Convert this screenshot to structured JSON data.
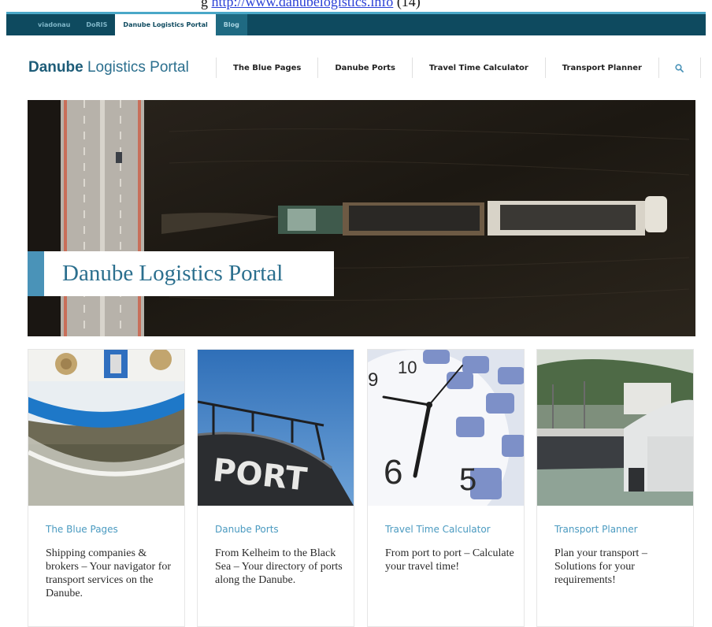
{
  "caption": {
    "text": "g",
    "link": "http://www.danubelogistics.info",
    "suffix": "(14)"
  },
  "topbar": {
    "tabs": [
      {
        "label": "viadonau"
      },
      {
        "label": "DoRIS"
      },
      {
        "label": "Danube Logistics Portal"
      },
      {
        "label": "Blog"
      }
    ],
    "colors": {
      "bar": "#0e4a5f",
      "accent": "#4aa8c8",
      "active_bg": "#ffffff"
    }
  },
  "header": {
    "logo_bold": "Danube",
    "logo_rest": " Logistics Portal",
    "nav": [
      {
        "label": "The Blue Pages"
      },
      {
        "label": "Danube Ports"
      },
      {
        "label": "Travel Time Calculator"
      },
      {
        "label": "Transport Planner"
      }
    ],
    "search_icon": "search-icon"
  },
  "hero": {
    "title": "Danube Logistics Portal",
    "image": "aerial-barge-on-river-with-bridge"
  },
  "cards": [
    {
      "title": "The Blue Pages",
      "description": "Shipping companies & brokers – Your navigator for transport services on the Danube.",
      "image": "ship-bow-with-ropes"
    },
    {
      "title": "Danube Ports",
      "description": "From Kelheim to the Black Sea – Your directory of ports along the Danube.",
      "image": "port-lettering-on-ship"
    },
    {
      "title": "Travel Time Calculator",
      "description": "From port to port – Calculate your travel time!",
      "image": "clock-and-calculator"
    },
    {
      "title": "Transport Planner",
      "description": "Plan your transport – Solutions for your requirements!",
      "image": "cargo-ship-at-terminal"
    }
  ],
  "colors": {
    "brand": "#2b6f8e",
    "link": "#4a9ac0",
    "hero_bar": "#4a93b8"
  }
}
